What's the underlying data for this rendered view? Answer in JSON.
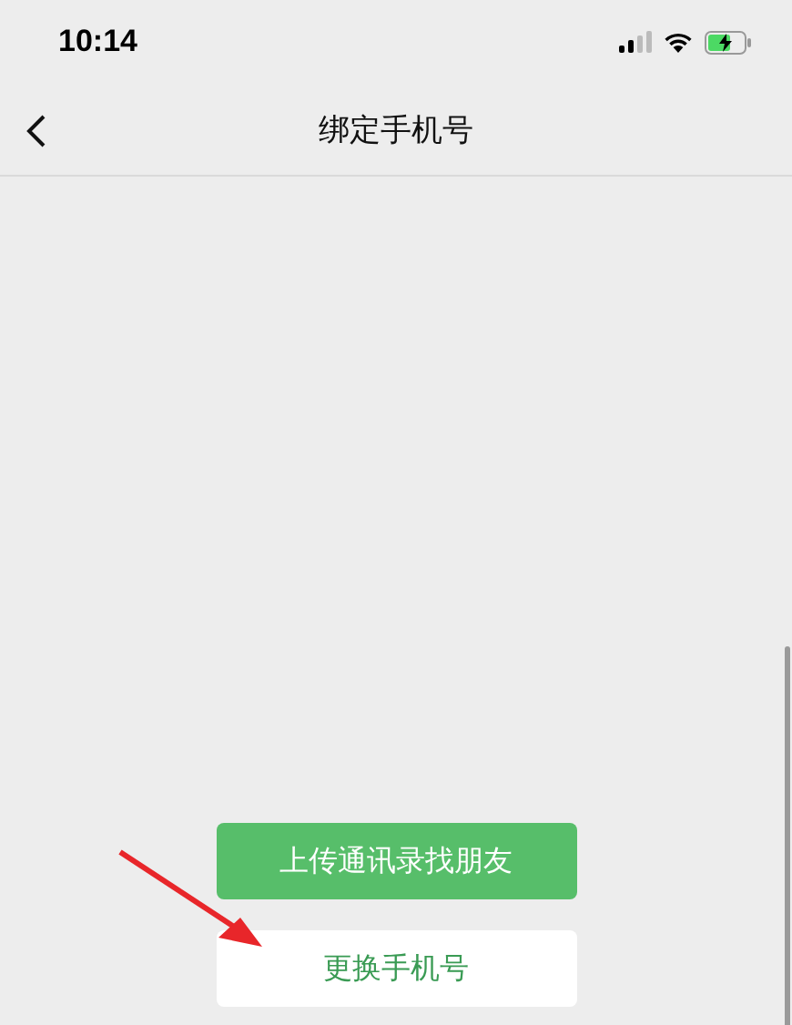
{
  "status_bar": {
    "time": "10:14"
  },
  "nav_bar": {
    "title": "绑定手机号"
  },
  "buttons": [
    {
      "label": "上传通讯录找朋友",
      "kind": "primary"
    },
    {
      "label": "更换手机号",
      "kind": "secondary"
    }
  ]
}
